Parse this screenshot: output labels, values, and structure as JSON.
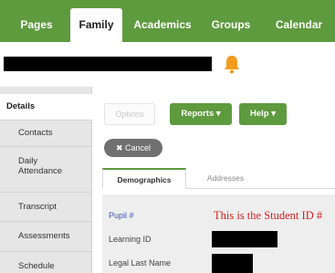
{
  "nav": {
    "tabs": [
      {
        "label": "Pages"
      },
      {
        "label": "Family"
      },
      {
        "label": "Academics"
      },
      {
        "label": "Groups"
      },
      {
        "label": "Calendar"
      }
    ],
    "active_tab": "Family"
  },
  "sidebar": {
    "items": [
      {
        "label": "Details"
      },
      {
        "label": "Contacts"
      },
      {
        "label": "Daily\nAttendance"
      },
      {
        "label": "Transcript"
      },
      {
        "label": "Assessments"
      },
      {
        "label": "Schedule"
      }
    ],
    "active": "Details"
  },
  "toolbar": {
    "options_label": "Options",
    "reports_label": "Reports ▾",
    "help_label": "Help ▾",
    "cancel_label": "✖ Cancel"
  },
  "subtabs": [
    {
      "label": "Demographics"
    },
    {
      "label": "Addresses"
    }
  ],
  "fields": [
    {
      "label": "Pupil #"
    },
    {
      "label": "Learning ID"
    },
    {
      "label": "Legal Last Name"
    }
  ],
  "annotation": "This is the Student ID #",
  "colors": {
    "brand_green": "#5e9a3e",
    "annotation_red": "#d32020",
    "link_blue": "#3b56b4",
    "bell_orange": "#f29b1d"
  },
  "icons": {
    "notification": "bell-icon",
    "cancel": "x-icon"
  }
}
